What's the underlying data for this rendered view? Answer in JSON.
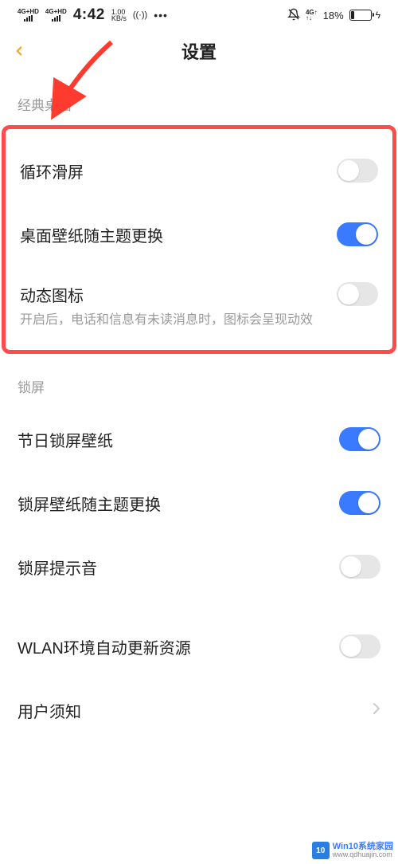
{
  "status": {
    "net1": "4G+HD",
    "net2": "4G+HD",
    "time": "4:42",
    "speed_num": "1.00",
    "speed_unit": "KB/s",
    "wifi_sym": "((·))",
    "dots": "•••",
    "net_up": "4G↑",
    "net_up_sub": "↑↓",
    "battery_pct": "18%",
    "bolt": "ϟ"
  },
  "header": {
    "title": "设置"
  },
  "sections": {
    "desktop": {
      "label": "经典桌面"
    },
    "lock": {
      "label": "锁屏"
    }
  },
  "rows": {
    "loop_slide": {
      "title": "循环滑屏",
      "on": false
    },
    "wallpaper_theme": {
      "title": "桌面壁纸随主题更换",
      "on": true
    },
    "dynamic_icon": {
      "title": "动态图标",
      "sub": "开启后，电话和信息有未读消息时，图标会呈现动效",
      "on": false
    },
    "holiday_lock": {
      "title": "节日锁屏壁纸",
      "on": true
    },
    "lock_wallpaper_theme": {
      "title": "锁屏壁纸随主题更换",
      "on": true
    },
    "lock_sound": {
      "title": "锁屏提示音",
      "on": false
    },
    "wlan_auto": {
      "title": "WLAN环境自动更新资源",
      "on": false
    },
    "user_notice": {
      "title": "用户须知"
    }
  },
  "watermark": {
    "badge": "10",
    "line1": "Win10系统家园",
    "line2": "www.qdhuajin.com"
  }
}
